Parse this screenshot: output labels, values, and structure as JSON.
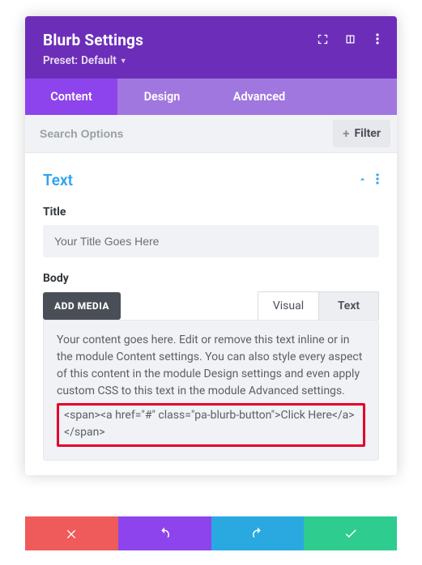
{
  "header": {
    "title": "Blurb Settings",
    "preset_label": "Preset:",
    "preset_value": "Default"
  },
  "tabs": {
    "content": "Content",
    "design": "Design",
    "advanced": "Advanced"
  },
  "search": {
    "placeholder": "Search Options",
    "filter_label": "Filter"
  },
  "section": {
    "title": "Text"
  },
  "title_field": {
    "label": "Title",
    "value": "Your Title Goes Here"
  },
  "body_field": {
    "label": "Body",
    "add_media": "ADD MEDIA",
    "tab_visual": "Visual",
    "tab_text": "Text",
    "content_intro": "Your content goes here. Edit or remove this text inline or in the module Content settings. You can also style every aspect of this content in the module Design settings and even apply custom CSS to this text in the module Advanced settings.",
    "content_highlight": "<span><a href=\"#\" class=\"pa-blurb-button\">Click Here</a></span>"
  },
  "colors": {
    "header_bg": "#6c2eb9",
    "tabs_bg": "#a077df",
    "tab_active": "#8e44ec",
    "accent_link": "#2ea3f2",
    "highlight_border": "#e4002b",
    "btn_close": "#ef5a5a",
    "btn_undo": "#8e44ec",
    "btn_redo": "#29a9e0",
    "btn_save": "#2ecc8f"
  }
}
